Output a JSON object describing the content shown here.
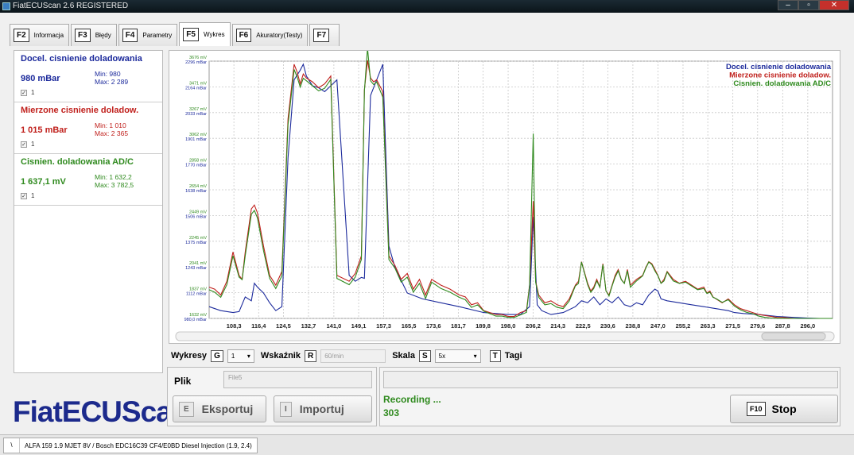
{
  "window": {
    "title": "FiatECUScan 2.6 REGISTERED",
    "minimize": "–",
    "maximize": "▫",
    "close": "✕"
  },
  "tabs": [
    {
      "key": "F2",
      "label": "Informacja"
    },
    {
      "key": "F3",
      "label": "Błędy"
    },
    {
      "key": "F4",
      "label": "Parametry"
    },
    {
      "key": "F5",
      "label": "Wykres",
      "active": true
    },
    {
      "key": "F6",
      "label": "Akuratory(Testy)"
    },
    {
      "key": "F7",
      "label": ""
    }
  ],
  "signals": [
    {
      "name": "Docel. cisnienie doladowania",
      "value": "980 mBar",
      "min": "Min: 980",
      "max": "Max: 2 289",
      "check": "1",
      "color": "#1c2a9c"
    },
    {
      "name": "Mierzone cisnienie doladow.",
      "value": "1 015 mBar",
      "min": "Min: 1 010",
      "max": "Max: 2 365",
      "check": "1",
      "color": "#c0201c"
    },
    {
      "name": "Cisnien. doladowania AD/C",
      "value": "1 637,1 mV",
      "min": "Min: 1 632,2",
      "max": "Max: 3 782,5",
      "check": "1",
      "color": "#2f8a1e"
    }
  ],
  "logo": "FiatECUScan",
  "controls": {
    "wykresy_label": "Wykresy",
    "wykresy_key": "G",
    "wykresy_value": "1",
    "wskaznik_label": "Wskaźnik",
    "wskaznik_key": "R",
    "wskaznik_value": "60/min",
    "skala_label": "Skala",
    "skala_key": "S",
    "skala_value": "5x",
    "tagi_key": "T",
    "tagi_label": "Tagi"
  },
  "file": {
    "label": "Plik",
    "filename": "File5",
    "export_key": "E",
    "export_label": "Eksportuj",
    "import_key": "I",
    "import_label": "Importuj"
  },
  "recording": {
    "status": "Recording ...",
    "count": "303",
    "stop_key": "F10",
    "stop_label": "Stop"
  },
  "statusbar": {
    "sep": "\\",
    "text": "ALFA 159 1.9 MJET 8V / Bosch EDC16C39 CF4/E0BD Diesel Injection (1.9, 2.4)"
  },
  "chart_data": {
    "type": "line",
    "legend_position": "top-right",
    "grid": true,
    "x_ticks": [
      "108,3",
      "116,4",
      "124,5",
      "132,7",
      "141,0",
      "149,1",
      "157,3",
      "165,5",
      "173,6",
      "181,7",
      "189,8",
      "198,0",
      "206,2",
      "214,3",
      "222,5",
      "230,6",
      "238,8",
      "247,0",
      "255,2",
      "263,3",
      "271,5",
      "279,6",
      "287,8",
      "296,0"
    ],
    "xlim": [
      100.2,
      304.1
    ],
    "y_ticks_mv": [
      "3676 mV",
      "3471 mV",
      "3267 mV",
      "3062 mV",
      "2858 mV",
      "2654 mV",
      "2449 mV",
      "2245 mV",
      "2041 mV",
      "1837 mV",
      "1632 mV"
    ],
    "y_ticks_mbar": [
      "2296 mBar",
      "2164 mBar",
      "2033 mBar",
      "1901 mBar",
      "1770 mBar",
      "1638 mBar",
      "1506 mBar",
      "1375 mBar",
      "1243 mBar",
      "1112 mBar",
      "980,0 mBar"
    ],
    "ylim_mbar": [
      980,
      2296
    ],
    "ylim_mv": [
      1632,
      3676
    ],
    "series": [
      {
        "name": "Docel. cisnienie doladowania",
        "unit": "mBar",
        "color": "#1c2a9c",
        "x": [
          100.2,
          104,
          108,
          110,
          112,
          114,
          115,
          116,
          118,
          120,
          122,
          124,
          126,
          128,
          130,
          131,
          132,
          134,
          136,
          138,
          140,
          142,
          146,
          148,
          150,
          151,
          153,
          155,
          157,
          159,
          161,
          165,
          170,
          176,
          182,
          190,
          198,
          202,
          205,
          206.2,
          207.5,
          209,
          212,
          216,
          220,
          222,
          224,
          226,
          228,
          230,
          232,
          234,
          236,
          238,
          240,
          242,
          244,
          246,
          247,
          248,
          250,
          254,
          258,
          262,
          266,
          270,
          272,
          275,
          280,
          286,
          292,
          296,
          300,
          304.1
        ],
        "y": [
          1040,
          1020,
          1010,
          1015,
          1090,
          1070,
          1160,
          1140,
          1110,
          1060,
          1020,
          1040,
          1800,
          2200,
          2250,
          2280,
          2220,
          2170,
          2160,
          2140,
          2170,
          2200,
          1200,
          1170,
          1190,
          1185,
          2120,
          2200,
          2280,
          1350,
          1240,
          1110,
          1080,
          1060,
          1040,
          1010,
          1000,
          1000,
          1040,
          1500,
          1050,
          1020,
          1000,
          1010,
          1040,
          1070,
          1060,
          1090,
          1050,
          1080,
          1060,
          1090,
          1050,
          1040,
          1060,
          1050,
          1100,
          1130,
          1120,
          1080,
          1070,
          1060,
          1050,
          1040,
          1030,
          1020,
          1010,
          1005,
          1000,
          990,
          985,
          982,
          980,
          980
        ]
      },
      {
        "name": "Mierzone cisnienie doladow.",
        "unit": "mBar",
        "color": "#c0201c",
        "x": [
          100.2,
          102,
          104,
          106,
          108,
          110,
          111,
          112,
          114,
          115,
          116,
          118,
          120,
          122,
          124,
          126,
          128,
          129,
          130,
          131,
          132,
          134,
          136,
          138,
          140,
          141,
          142,
          146,
          148,
          150,
          151,
          152,
          153,
          154,
          155,
          157,
          159,
          161,
          163,
          165,
          167,
          169,
          171,
          173,
          176,
          179,
          182,
          184,
          186,
          188,
          190,
          192,
          194,
          196,
          198,
          200,
          202,
          204,
          205,
          206.2,
          207,
          208,
          209,
          210,
          212,
          214,
          216,
          218,
          220,
          221,
          222,
          224,
          225,
          226,
          227,
          228,
          229,
          230,
          231,
          232,
          233,
          234,
          235,
          236,
          237,
          238,
          240,
          242,
          243,
          244,
          245,
          246,
          247,
          248,
          249,
          250,
          252,
          254,
          256,
          258,
          260,
          262,
          263,
          264,
          265,
          266,
          268,
          270,
          272,
          274,
          276,
          278,
          280,
          282,
          284,
          286,
          288,
          290,
          292,
          296,
          300,
          304.1
        ],
        "y": [
          1140,
          1130,
          1100,
          1170,
          1320,
          1200,
          1180,
          1320,
          1540,
          1560,
          1520,
          1350,
          1200,
          1150,
          1220,
          2000,
          2280,
          2240,
          2180,
          2230,
          2210,
          2190,
          2160,
          2180,
          2220,
          1700,
          1200,
          1170,
          1210,
          1300,
          2150,
          2300,
          2210,
          2190,
          2200,
          2140,
          1300,
          1250,
          1180,
          1210,
          1130,
          1180,
          1100,
          1180,
          1150,
          1130,
          1100,
          1090,
          1050,
          1060,
          1020,
          1010,
          1000,
          1000,
          990,
          990,
          1010,
          1020,
          1150,
          1580,
          1170,
          1100,
          1080,
          1060,
          1070,
          1050,
          1040,
          1080,
          1150,
          1170,
          1270,
          1160,
          1120,
          1140,
          1180,
          1140,
          1260,
          1120,
          1100,
          1150,
          1200,
          1230,
          1180,
          1160,
          1230,
          1150,
          1180,
          1200,
          1240,
          1270,
          1260,
          1230,
          1200,
          1160,
          1180,
          1220,
          1180,
          1160,
          1170,
          1150,
          1130,
          1140,
          1110,
          1120,
          1090,
          1080,
          1060,
          1080,
          1050,
          1030,
          1020,
          1010,
          1000,
          995,
          990,
          985,
          985,
          982,
          980,
          980,
          980,
          980
        ]
      },
      {
        "name": "Cisnien. doladowania AD/C",
        "unit": "mV",
        "color": "#2f8a1e",
        "x": [
          100.2,
          102,
          104,
          106,
          108,
          110,
          111,
          112,
          114,
          115,
          116,
          118,
          120,
          122,
          124,
          126,
          128,
          129,
          130,
          131,
          132,
          134,
          136,
          138,
          140,
          141,
          142,
          146,
          148,
          150,
          151,
          152,
          153,
          154,
          155,
          157,
          159,
          161,
          163,
          165,
          167,
          169,
          171,
          173,
          176,
          179,
          182,
          184,
          186,
          188,
          190,
          192,
          194,
          196,
          198,
          200,
          202,
          204,
          205,
          206.2,
          207,
          208,
          209,
          210,
          212,
          214,
          216,
          218,
          220,
          221,
          222,
          224,
          225,
          226,
          227,
          228,
          229,
          230,
          231,
          232,
          233,
          234,
          235,
          236,
          237,
          238,
          240,
          242,
          243,
          244,
          245,
          246,
          247,
          248,
          249,
          250,
          252,
          254,
          256,
          258,
          260,
          262,
          263,
          264,
          265,
          266,
          268,
          270,
          272,
          274,
          276,
          278,
          280,
          282,
          284,
          286,
          288,
          290,
          292,
          296,
          300,
          304.1
        ],
        "y": [
          1860,
          1840,
          1800,
          1900,
          2130,
          1960,
          1940,
          2130,
          2460,
          2490,
          2430,
          2170,
          1950,
          1870,
          1970,
          3170,
          3610,
          3550,
          3470,
          3540,
          3520,
          3480,
          3440,
          3460,
          3530,
          2720,
          1950,
          1900,
          1960,
          2100,
          3440,
          3780,
          3520,
          3490,
          3510,
          3390,
          2100,
          2030,
          1920,
          1960,
          1840,
          1910,
          1790,
          1920,
          1870,
          1840,
          1800,
          1780,
          1720,
          1740,
          1690,
          1670,
          1650,
          1650,
          1640,
          1640,
          1660,
          1680,
          1890,
          3100,
          1920,
          1800,
          1770,
          1740,
          1750,
          1720,
          1710,
          1770,
          1890,
          1910,
          2080,
          1900,
          1840,
          1870,
          1930,
          1880,
          2060,
          1850,
          1810,
          1890,
          1960,
          2010,
          1940,
          1910,
          2010,
          1880,
          1930,
          1970,
          2030,
          2080,
          2060,
          2010,
          1970,
          1910,
          1930,
          2000,
          1930,
          1910,
          1920,
          1890,
          1860,
          1870,
          1830,
          1840,
          1800,
          1790,
          1760,
          1780,
          1730,
          1700,
          1680,
          1670,
          1650,
          1640,
          1635,
          1633,
          1633,
          1632,
          1632,
          1632,
          1632,
          1632
        ]
      }
    ]
  }
}
